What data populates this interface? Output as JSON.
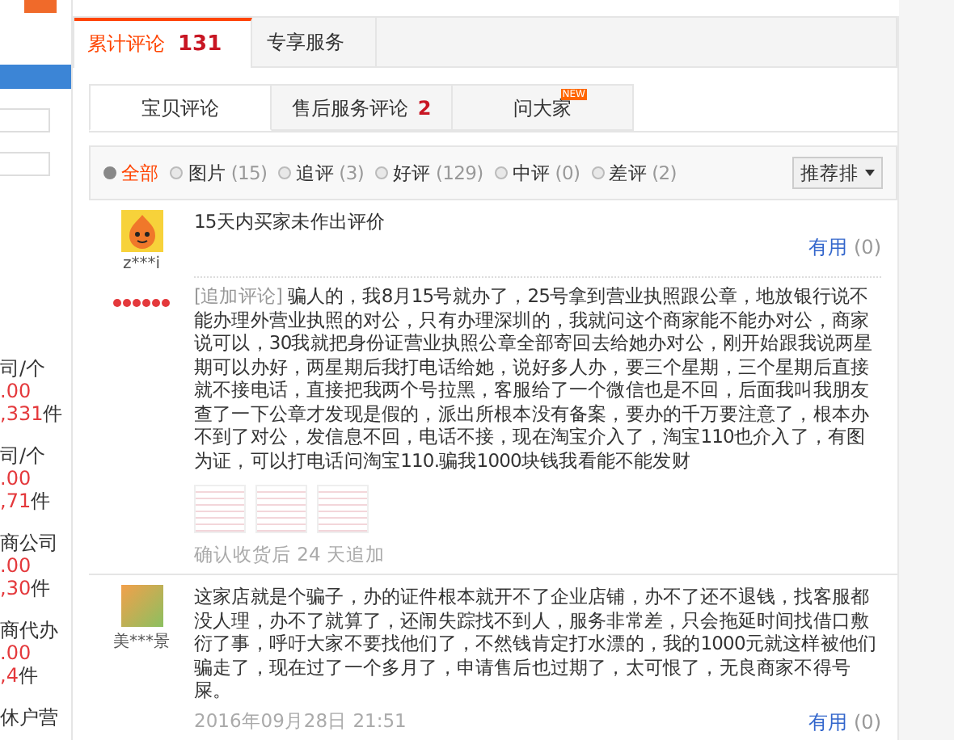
{
  "sidebar": {
    "items": [
      {
        "title": "司/个",
        "price": ".00",
        "count": ",331",
        "unit": "件"
      },
      {
        "title": "司/个",
        "price": ".00",
        "count": ",71",
        "unit": "件"
      },
      {
        "title": "商公司",
        "price": ".00",
        "count": ",30",
        "unit": "件"
      },
      {
        "title": "商代办",
        "price": ".00",
        "count": ",4",
        "unit": "件"
      },
      {
        "title": "休户营"
      }
    ]
  },
  "main_tabs": [
    {
      "label": "累计评论",
      "count": "131",
      "selected": true
    },
    {
      "label": "专享服务",
      "selected": false
    }
  ],
  "sub_tabs": [
    {
      "label": "宝贝评论",
      "selected": true
    },
    {
      "label": "售后服务评论",
      "count": "2",
      "selected": false
    },
    {
      "label": "问大家",
      "badge": "NEW",
      "selected": false
    }
  ],
  "filters": [
    {
      "label": "全部",
      "selected": true
    },
    {
      "label": "图片",
      "count": "(15)",
      "selected": false
    },
    {
      "label": "追评",
      "count": "(3)",
      "selected": false
    },
    {
      "label": "好评",
      "count": "(129)",
      "selected": false
    },
    {
      "label": "中评",
      "count": "(0)",
      "selected": false
    },
    {
      "label": "差评",
      "count": "(2)",
      "selected": false
    }
  ],
  "sort": {
    "label": "推荐排"
  },
  "reviews": [
    {
      "kind": "cartoon",
      "user": "z***i",
      "rank_badge": true,
      "content": "15天内买家未作出评价",
      "helpful": {
        "label": "有用",
        "count": "(0)"
      },
      "followup": {
        "tag": "[追加评论]",
        "text": "骗人的，我8月15号就办了，25号拿到营业执照跟公章，地放银行说不能办理外营业执照的对公，只有办理深圳的，我就问这个商家能不能办对公，商家说可以，30我就把身份证营业执照公章全部寄回去给她办对公，刚开始跟我说两星期可以办好，两星期后我打电话给她，说好多人办，要三个星期，三个星期后直接就不接电话，直接把我两个号拉黑，客服给了一个微信也是不回，后面我叫我朋友查了一下公章才发现是假的，派出所根本没有备案，要办的千万要注意了，根本办不到了对公，发信息不回，电话不接，现在淘宝介入了，淘宝110也介入了，有图为证，可以打电话问淘宝110.骗我1000块钱我看能不能发财",
        "has_photos": true,
        "note": "确认收货后 24 天追加"
      }
    },
    {
      "kind": "photo",
      "user": "美***景",
      "rank_badge": false,
      "content": "这家店就是个骗子，办的证件根本就开不了企业店铺，办不了还不退钱，找客服都没人理，办不了就算了，还闹失踪找不到人，服务非常差，只会拖延时间找借口敷衍了事，呼吁大家不要找他们了，不然钱肯定打水漂的，我的1000元就这样被他们骗走了，现在过了一个多月了，申请售后也过期了，太可恨了，无良商家不得号屎。",
      "date": "2016年09月28日 21:51",
      "helpful": {
        "label": "有用",
        "count": "(0)"
      }
    }
  ]
}
